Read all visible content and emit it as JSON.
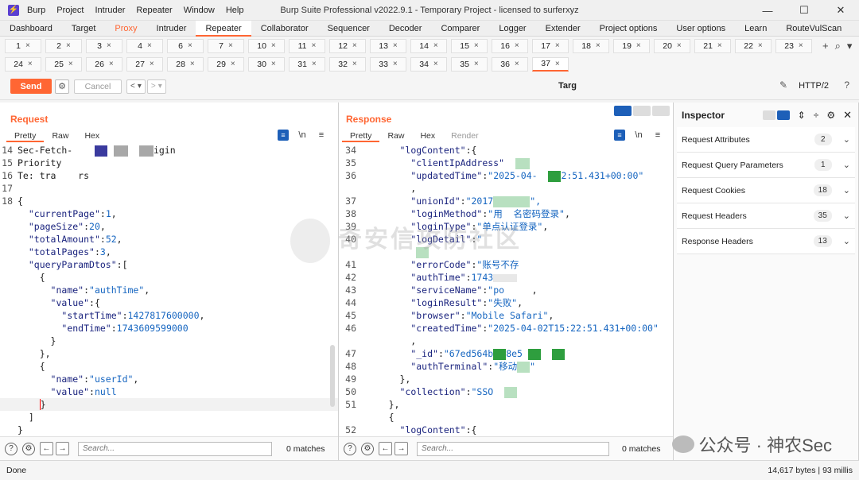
{
  "window": {
    "title": "Burp Suite Professional v2022.9.1 - Temporary Project - licensed to surferxyz",
    "menu": [
      "Burp",
      "Project",
      "Intruder",
      "Repeater",
      "Window",
      "Help"
    ]
  },
  "main_tabs": [
    "Dashboard",
    "Target",
    "Proxy",
    "Intruder",
    "Repeater",
    "Collaborator",
    "Sequencer",
    "Decoder",
    "Comparer",
    "Logger",
    "Extender",
    "Project options",
    "User options",
    "Learn",
    "RouteVulScan"
  ],
  "repeater_tabs_row1": [
    "1",
    "2",
    "3",
    "4",
    "6",
    "7",
    "10",
    "11",
    "12",
    "13",
    "14",
    "15",
    "16",
    "17",
    "18",
    "19",
    "20",
    "21",
    "22",
    "23"
  ],
  "repeater_tabs_row2": [
    "24",
    "25",
    "26",
    "27",
    "28",
    "29",
    "30",
    "31",
    "32",
    "33",
    "34",
    "35",
    "36",
    "37"
  ],
  "toolbar": {
    "send": "Send",
    "cancel": "Cancel",
    "target": "Targ",
    "protocol": "HTTP/2"
  },
  "request": {
    "title": "Request",
    "tabs": [
      "Pretty",
      "Raw",
      "Hex"
    ],
    "search_placeholder": "Search...",
    "matches": "0 matches"
  },
  "response": {
    "title": "Response",
    "tabs": [
      "Pretty",
      "Raw",
      "Hex",
      "Render"
    ],
    "search_placeholder": "Search...",
    "matches": "0 matches"
  },
  "inspector": {
    "title": "Inspector",
    "sections": [
      {
        "label": "Request Attributes",
        "count": "2"
      },
      {
        "label": "Request Query Parameters",
        "count": "1"
      },
      {
        "label": "Request Cookies",
        "count": "18"
      },
      {
        "label": "Request Headers",
        "count": "35"
      },
      {
        "label": "Response Headers",
        "count": "13"
      }
    ]
  },
  "status": {
    "left": "Done",
    "right": "14,617 bytes | 93 millis"
  },
  "watermark": "奇安信攻防社区",
  "brand": "公众号 · 神农Sec",
  "colors": {
    "accent": "#ff6633",
    "json_key": "#1a237e",
    "json_value": "#1565c0",
    "redaction_blue": "#3a3a9e",
    "redaction_gray": "#a8a8a8",
    "redaction_green": "#2e9e3e",
    "redaction_light_green": "#b8e0c0"
  }
}
